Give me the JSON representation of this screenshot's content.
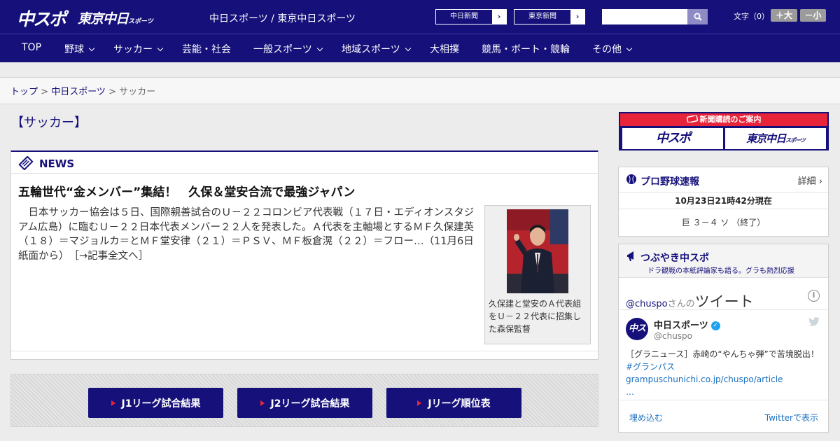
{
  "header": {
    "logo_main": "中スポ",
    "logo_tokyo": "東京中日",
    "logo_tokyo_small": "スポーツ",
    "site_title": "中日スポーツ / 東京中日スポーツ",
    "paper_links": [
      {
        "label": "中日新聞",
        "arrow": "›"
      },
      {
        "label": "東京新聞",
        "arrow": "›"
      }
    ],
    "search_placeholder": "",
    "font_size_label": "文字（0）",
    "font_up": "＋大",
    "font_down": "－小"
  },
  "nav": [
    {
      "label": "TOP",
      "dropdown": false
    },
    {
      "label": "野球",
      "dropdown": true
    },
    {
      "label": "サッカー",
      "dropdown": true
    },
    {
      "label": "芸能・社会",
      "dropdown": false
    },
    {
      "label": "一般スポーツ",
      "dropdown": true
    },
    {
      "label": "地域スポーツ",
      "dropdown": true
    },
    {
      "label": "大相撲",
      "dropdown": false
    },
    {
      "label": "競馬・ボート・競輪",
      "dropdown": false
    },
    {
      "label": "その他",
      "dropdown": true
    }
  ],
  "breadcrumb": {
    "top": "トップ",
    "sep": " > ",
    "chunichi": "中日スポーツ",
    "current": "サッカー"
  },
  "page_title": "【サッカー】",
  "news": {
    "label": "NEWS",
    "headline": "五輪世代“金メンバー”集結！　久保＆堂安合流で最強ジャパン",
    "body": "　日本サッカー協会は５日、国際親善試合のＵ－２２コロンビア代表戦（１７日・エディオンスタジアム広島）に臨むＵ－２２日本代表メンバー２２人を発表した。Ａ代表を主軸場とするＭＦ久保建英（１８）＝マジョルカ＝とＭＦ堂安律（２１）＝ＰＳＶ、ＭＦ板倉滉（２２）＝フロー…（11月6日 紙面から）",
    "more_link": "［→記事全文へ］",
    "caption": "久保建と堂安のＡ代表組をＵ－２２代表に招集した森保監督"
  },
  "league_buttons": [
    "J1リーグ試合結果",
    "J2リーグ試合結果",
    "Jリーグ順位表"
  ],
  "sidebar": {
    "subscribe_head": "新聞購読のご案内",
    "subscribe_logos": [
      "中スポ",
      "東京中日"
    ],
    "subscribe_logo_small": "スポーツ",
    "baseball": {
      "title": "プロ野球速報",
      "detail": "詳細 ›",
      "time": "10月23日21時42分現在",
      "score": "巨 ３－４ ソ （終了）"
    },
    "tweets": {
      "title": "つぶやき中スポ",
      "subtitle": "ドラ観戦の本紙評論家も語る。グラも熱烈応援",
      "user": "@chuspo",
      "user_suffix": "さんの",
      "tweet_word": "ツイート",
      "info": "i",
      "avatar_text": "中スポ",
      "name": "中日スポーツ",
      "verified": "✓",
      "handle": "@chuspo",
      "text": "［グラニュース］赤崎の“やんちゃ弾”で苦境脱出！",
      "tag1": "#グランパス",
      "tag2": "grampuschunichi.co.jp/chuspo/article",
      "ellipsis": "…",
      "embed": "埋め込む",
      "view": "Twitterで表示"
    }
  },
  "colors": {
    "brand": "#15107a",
    "accent": "#e8243a",
    "link": "#1b6fbf"
  }
}
